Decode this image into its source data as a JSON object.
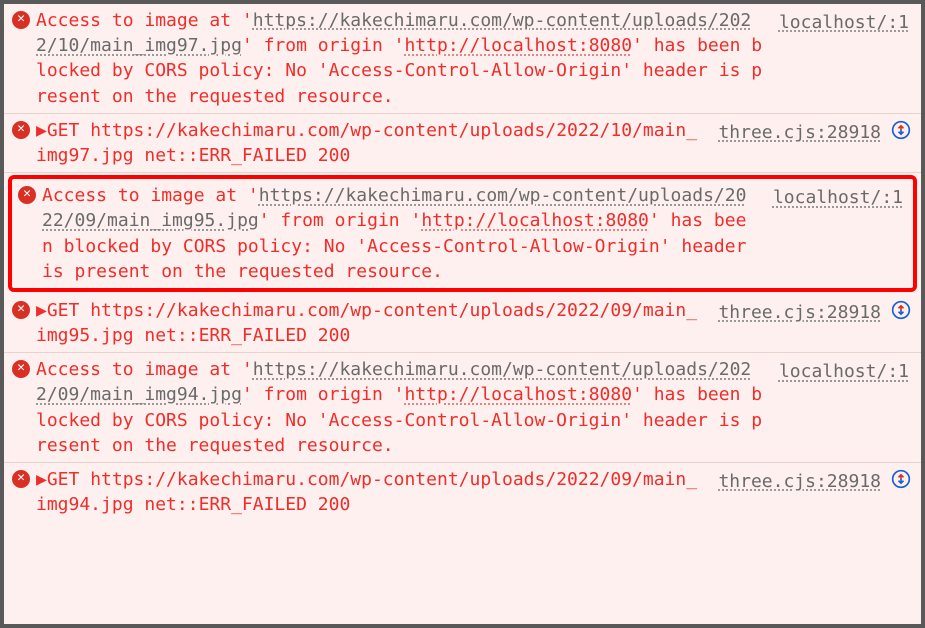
{
  "cors1": {
    "t1": "Access to image at '",
    "url1": "https://kakechimaru.com/wp-content/uploads/2022/10/main_img97.jpg",
    "t2": "' from origin '",
    "url2": "http://localhost:8080",
    "t3": "' has been blocked by CORS policy: No 'Access-Control-Allow-Origin' header is present on the requested resource.",
    "src": "localhost/:1"
  },
  "get1": {
    "method": "GET",
    "url": "https://kakechimaru.com/wp-content/uploads/2022/10/main_img97.jpg",
    "err": " net::ERR_FAILED 200",
    "src": "three.cjs:28918"
  },
  "cors2": {
    "t1": "Access to image at '",
    "url1": "https://kakechimaru.com/wp-content/uploads/2022/09/main_img95.jpg",
    "t2": "' from origin '",
    "url2": "http://localhost:8080",
    "t3": "' has been blocked by CORS policy: No 'Access-Control-Allow-Origin' header is present on the requested resource.",
    "src": "localhost/:1"
  },
  "get2": {
    "method": "GET",
    "url": "https://kakechimaru.com/wp-content/uploads/2022/09/main_img95.jpg",
    "err": " net::ERR_FAILED 200",
    "src": "three.cjs:28918"
  },
  "cors3": {
    "t1": "Access to image at '",
    "url1": "https://kakechimaru.com/wp-content/uploads/2022/09/main_img94.jpg",
    "t2": "' from origin '",
    "url2": "http://localhost:8080",
    "t3": "' has been blocked by CORS policy: No 'Access-Control-Allow-Origin' header is present on the requested resource.",
    "src": "localhost/:1"
  },
  "get3": {
    "method": "GET",
    "url": "https://kakechimaru.com/wp-content/uploads/2022/09/main_img94.jpg",
    "err": " net::ERR_FAILED 200",
    "src": "three.cjs:28918"
  }
}
